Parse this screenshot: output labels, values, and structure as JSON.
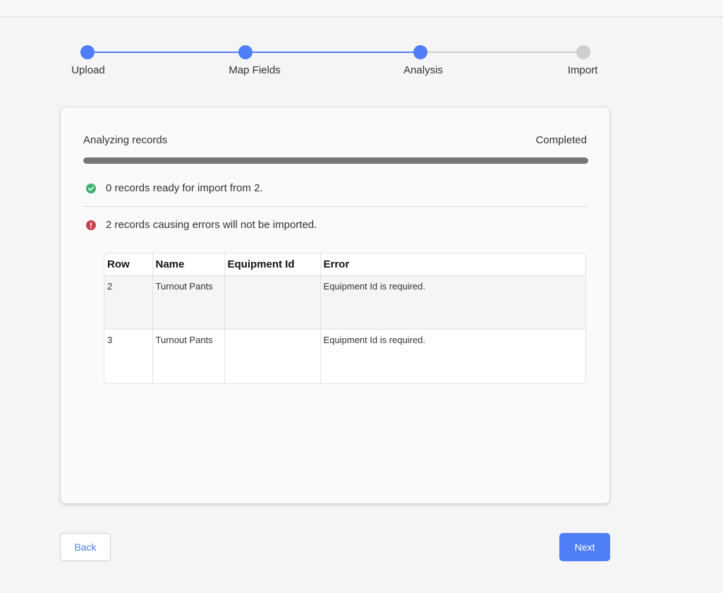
{
  "stepper": {
    "steps": [
      {
        "label": "Upload",
        "state": "complete"
      },
      {
        "label": "Map Fields",
        "state": "complete"
      },
      {
        "label": "Analysis",
        "state": "current"
      },
      {
        "label": "Import",
        "state": "pending"
      }
    ],
    "active_color": "#4f7ef8",
    "inactive_color": "#cfcfcf"
  },
  "analysis": {
    "label": "Analyzing records",
    "status": "Completed",
    "progress_percent": 100,
    "success_message": "0 records ready for import from 2.",
    "success_icon": "check-circle-icon",
    "success_color": "#3cb371",
    "error_message": "2 records causing errors will not be imported.",
    "error_icon": "exclamation-circle-icon",
    "error_color": "#c9424f"
  },
  "errors_table": {
    "columns": [
      "Row",
      "Name",
      "Equipment Id",
      "Error"
    ],
    "rows": [
      {
        "row": "2",
        "name": "Turnout Pants",
        "equipment_id": "",
        "error": "Equipment Id is required."
      },
      {
        "row": "3",
        "name": "Turnout Pants",
        "equipment_id": "",
        "error": "Equipment Id is required."
      }
    ]
  },
  "footer": {
    "back_label": "Back",
    "next_label": "Next"
  }
}
